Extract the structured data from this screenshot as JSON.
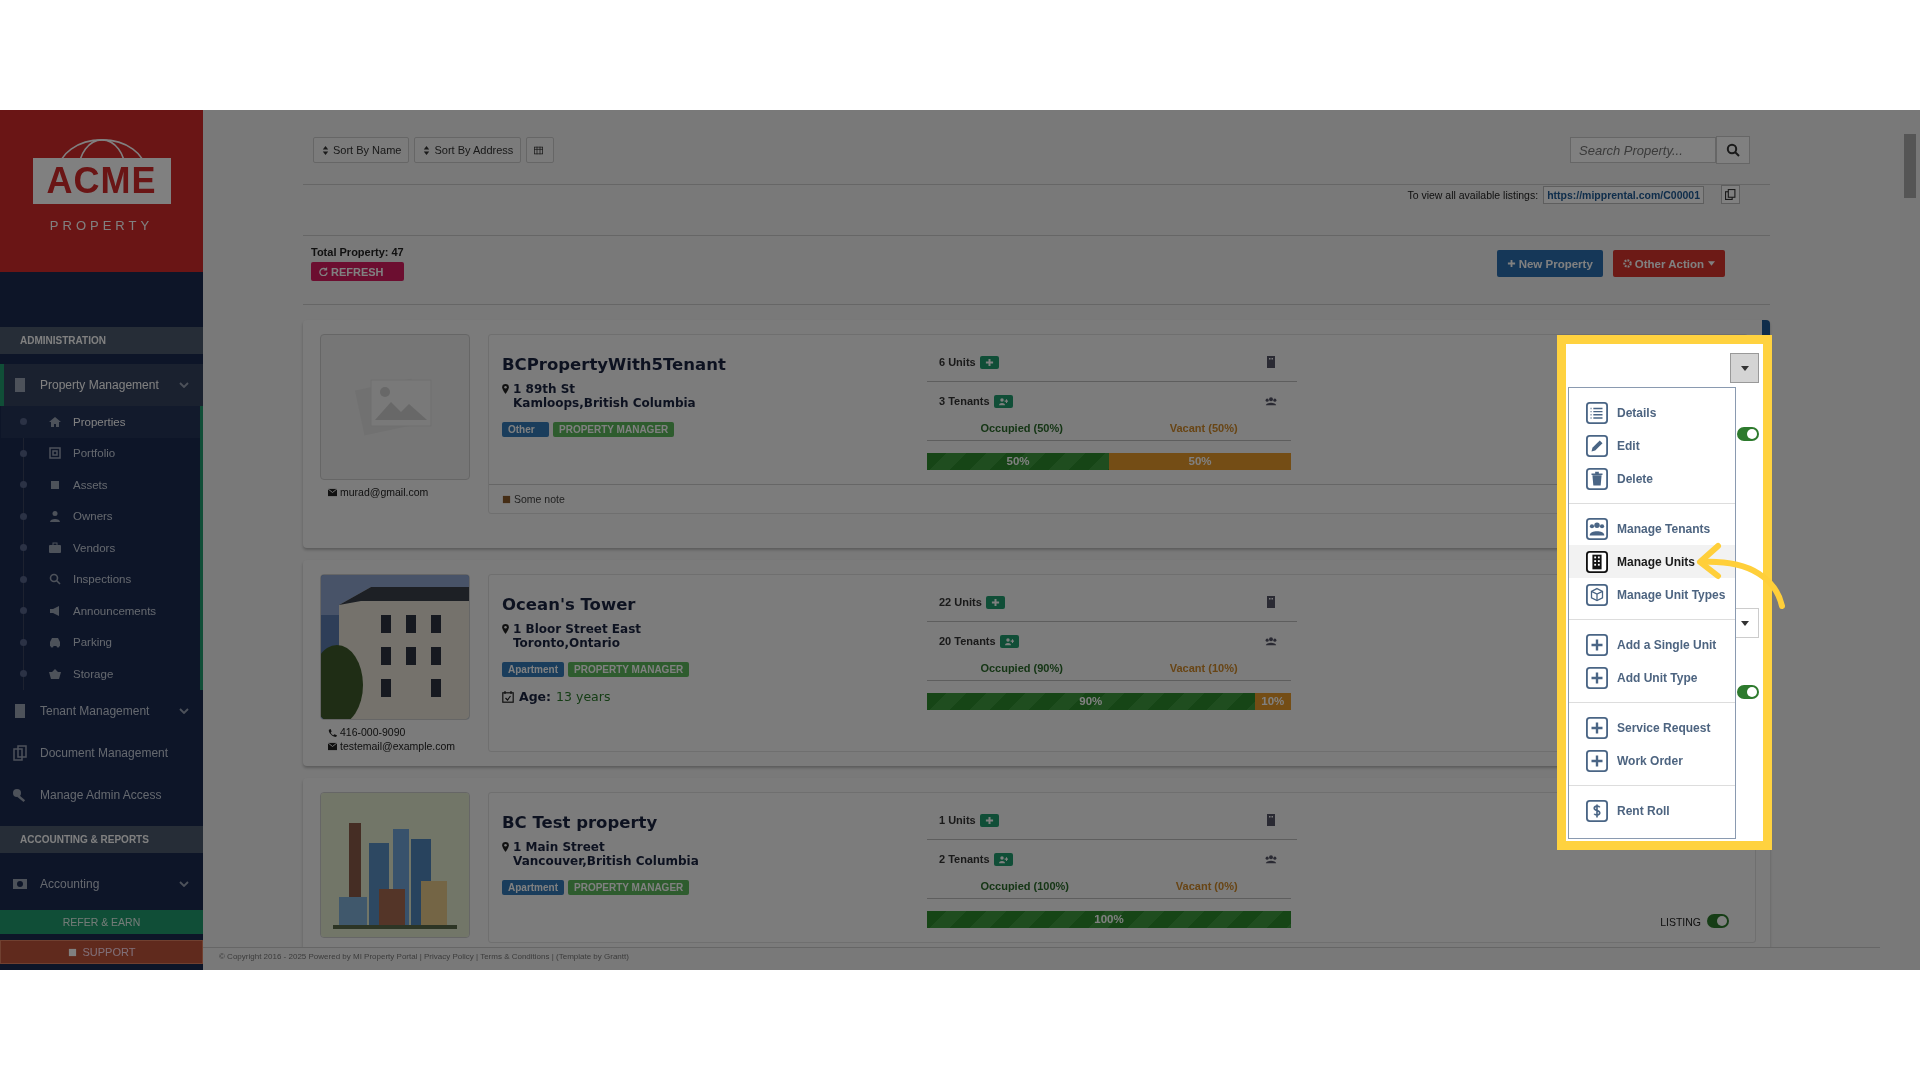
{
  "logo": {
    "name": "ACME",
    "sub": "PROPERTY"
  },
  "sidebar": {
    "sections": [
      {
        "kind": "header",
        "label": "ADMINISTRATION"
      },
      {
        "kind": "group",
        "label": "Property Management",
        "selected": true,
        "children": [
          {
            "label": "Properties",
            "selected": true
          },
          {
            "label": "Portfolio",
            "selected": false
          },
          {
            "label": "Assets",
            "selected": false
          },
          {
            "label": "Owners",
            "selected": false
          },
          {
            "label": "Vendors",
            "selected": false
          },
          {
            "label": "Inspections",
            "selected": false
          },
          {
            "label": "Announcements",
            "selected": false
          },
          {
            "label": "Parking",
            "selected": false
          },
          {
            "label": "Storage",
            "selected": false
          }
        ]
      },
      {
        "kind": "group",
        "label": "Tenant Management",
        "selected": false
      },
      {
        "kind": "link",
        "label": "Document Management",
        "selected": false
      },
      {
        "kind": "link",
        "label": "Manage Admin Access",
        "selected": false
      },
      {
        "kind": "header",
        "label": "ACCOUNTING & REPORTS"
      },
      {
        "kind": "group",
        "label": "Accounting",
        "selected": false
      }
    ],
    "refer": "REFER & EARN",
    "support": "SUPPORT"
  },
  "toolbar": {
    "sorts": [
      "Sort By Name",
      "Sort By Address"
    ],
    "search": {
      "placeholder": "Search Property..."
    }
  },
  "listings": {
    "label": "To view all available listings:",
    "link": "https://mipprental.com/C00001"
  },
  "total": "Total Property: 47",
  "refresh": "REFRESH",
  "new_property": "New Property",
  "other_action": "Other Action",
  "properties": [
    {
      "name": "BCPropertyWith5Tenant",
      "street": "1 89th St",
      "city": "Kamloops,British Columbia",
      "tags": [
        {
          "label": "Other",
          "kind": "type"
        },
        {
          "label": "PROPERTY MANAGER",
          "kind": "role"
        }
      ],
      "kind": "placeholder",
      "contacts": [
        {
          "kind": "email",
          "text": "murad@gmail.com"
        }
      ],
      "note": "Some note",
      "units": "6 Units",
      "tenants": "3 Tenants",
      "occupied": "Occupied (50%)",
      "vacant": "Vacant (50%)",
      "level": 0.5,
      "occupied_bar": "50%",
      "vacant_bar": "50%",
      "listing_on": true
    },
    {
      "name": "Ocean's Tower",
      "street": "1 Bloor Street East",
      "city": "Toronto,Ontario",
      "tags": [
        {
          "label": "Apartment",
          "kind": "type"
        },
        {
          "label": "PROPERTY MANAGER",
          "kind": "role"
        }
      ],
      "kind": "picture",
      "age_label": "Age:",
      "age": "13 years",
      "contacts": [
        {
          "kind": "phone",
          "text": "416-000-9090"
        },
        {
          "kind": "email",
          "text": "testemail@example.com"
        }
      ],
      "units": "22 Units",
      "tenants": "20 Tenants",
      "occupied": "Occupied (90%)",
      "vacant": "Vacant (10%)",
      "level": 0.9,
      "occupied_bar": "90%",
      "vacant_bar": "10%",
      "listing_on": true
    },
    {
      "name": "BC Test property",
      "street": "1 Main Street",
      "city": "Vancouver,British Columbia",
      "tags": [
        {
          "label": "Apartment",
          "kind": "type"
        },
        {
          "label": "PROPERTY MANAGER",
          "kind": "role"
        }
      ],
      "kind": "picture",
      "units": "1 Units",
      "tenants": "2 Tenants",
      "occupied": "Occupied (100%)",
      "vacant": "Vacant (0%)",
      "level": 1,
      "occupied_bar": "100%",
      "listing_label": "LISTING",
      "listing_on": true
    }
  ],
  "action_menu": {
    "groups": [
      {
        "items": [
          {
            "label": "Details",
            "selected": false
          },
          {
            "label": "Edit",
            "selected": false
          },
          {
            "label": "Delete",
            "selected": false
          }
        ]
      },
      {
        "items": [
          {
            "label": "Manage Tenants",
            "selected": false
          },
          {
            "label": "Manage Units",
            "selected": true
          },
          {
            "label": "Manage Unit Types",
            "selected": false
          }
        ]
      },
      {
        "items": [
          {
            "label": "Add a Single Unit",
            "selected": false
          },
          {
            "label": "Add Unit Type",
            "selected": false
          }
        ]
      },
      {
        "items": [
          {
            "label": "Service Request",
            "selected": false
          },
          {
            "label": "Work Order",
            "selected": false
          }
        ]
      },
      {
        "items": [
          {
            "label": "Rent Roll",
            "selected": false
          }
        ]
      }
    ]
  },
  "footer": "© Copyright 2016 - 2025 Powered by MI Property Portal | Privacy Policy | Terms & Conditions | (Template by Grantt)"
}
